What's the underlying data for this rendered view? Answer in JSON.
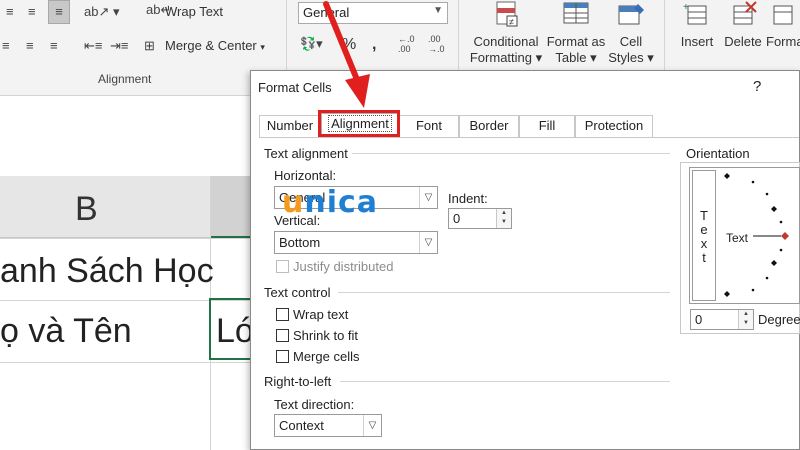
{
  "ribbon": {
    "wrap_text": "Wrap Text",
    "merge_center": "Merge & Center",
    "alignment_group": "Alignment",
    "number_format": "General",
    "percent": "%",
    "comma": ",",
    "inc_decimal": "←.0\n.00",
    "dec_decimal": ".00\n→.0",
    "conditional_formatting": [
      "Conditional",
      "Formatting ▾"
    ],
    "format_as_table": [
      "Format as",
      "Table ▾"
    ],
    "cell_styles": [
      "Cell",
      "Styles ▾"
    ],
    "insert": "Insert",
    "delete": "Delete",
    "format": "Forma"
  },
  "sheet": {
    "column_letter": "B",
    "row1": "anh Sách Học",
    "row2_left": "ọ và Tên",
    "row2_right": "Ló"
  },
  "dialog": {
    "title": "Format Cells",
    "help": "?",
    "tabs": [
      "Number",
      "Alignment",
      "Font",
      "Border",
      "Fill",
      "Protection"
    ],
    "active_tab": "Alignment",
    "text_alignment": {
      "title": "Text alignment",
      "horizontal_label": "Horizontal:",
      "horizontal_value": "General",
      "indent_label": "Indent:",
      "indent_value": "0",
      "vertical_label": "Vertical:",
      "vertical_value": "Bottom",
      "justify_distributed": "Justify distributed"
    },
    "text_control": {
      "title": "Text control",
      "wrap_text": "Wrap text",
      "shrink_to_fit": "Shrink to fit",
      "merge_cells": "Merge cells"
    },
    "rtl": {
      "title": "Right-to-left",
      "direction_label": "Text direction:",
      "direction_value": "Context"
    },
    "orientation": {
      "title": "Orientation",
      "vertical_text": "Text",
      "horizontal_text": "Text",
      "degrees_value": "0",
      "degrees_label": "Degree"
    }
  },
  "watermark": {
    "u": "u",
    "nica": "nica"
  },
  "colors": {
    "annotation_red": "#e0201e",
    "excel_green": "#217346"
  }
}
